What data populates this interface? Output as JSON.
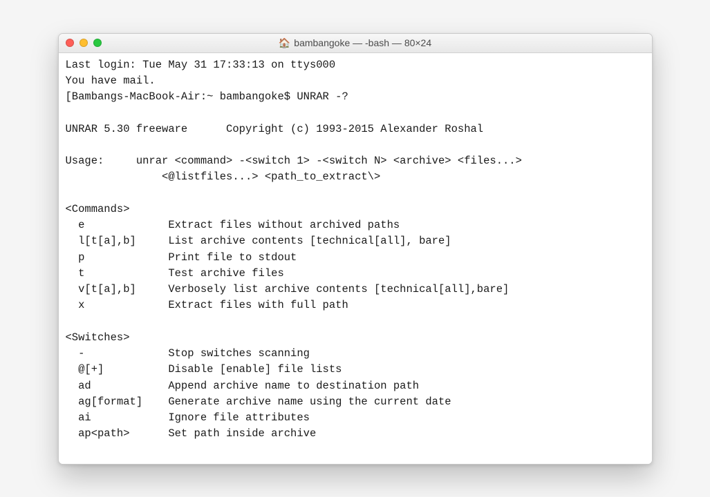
{
  "window": {
    "title_user": "bambangoke",
    "title_suffix": " — -bash — 80×24"
  },
  "terminal": {
    "lines": [
      "Last login: Tue May 31 17:33:13 on ttys000",
      "You have mail.",
      "[Bambangs-MacBook-Air:~ bambangoke$ UNRAR -?",
      "",
      "UNRAR 5.30 freeware      Copyright (c) 1993-2015 Alexander Roshal",
      "",
      "Usage:     unrar <command> -<switch 1> -<switch N> <archive> <files...>",
      "               <@listfiles...> <path_to_extract\\>",
      "",
      "<Commands>",
      "  e             Extract files without archived paths",
      "  l[t[a],b]     List archive contents [technical[all], bare]",
      "  p             Print file to stdout",
      "  t             Test archive files",
      "  v[t[a],b]     Verbosely list archive contents [technical[all],bare]",
      "  x             Extract files with full path",
      "",
      "<Switches>",
      "  -             Stop switches scanning",
      "  @[+]          Disable [enable] file lists",
      "  ad            Append archive name to destination path",
      "  ag[format]    Generate archive name using the current date",
      "  ai            Ignore file attributes",
      "  ap<path>      Set path inside archive"
    ]
  }
}
